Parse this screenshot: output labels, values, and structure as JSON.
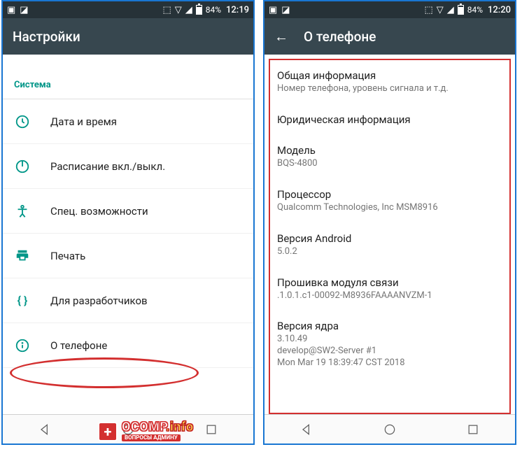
{
  "left": {
    "statusbar": {
      "battery": "84%",
      "time": "12:19"
    },
    "toolbar": {
      "title": "Настройки"
    },
    "section": "Система",
    "items": [
      {
        "label": "Дата и время"
      },
      {
        "label": "Расписание вкл./выкл."
      },
      {
        "label": "Спец. возможности"
      },
      {
        "label": "Печать"
      },
      {
        "label": "Для разработчиков"
      },
      {
        "label": "О телефоне"
      }
    ]
  },
  "right": {
    "statusbar": {
      "battery": "84%",
      "time": "12:20"
    },
    "toolbar": {
      "title": "О телефоне"
    },
    "info": [
      {
        "title": "Общая информация",
        "sub": "Номер телефона, уровень сигнала и т.д."
      },
      {
        "title": "Юридическая информация",
        "sub": ""
      },
      {
        "title": "Модель",
        "sub": "BQS-4800"
      },
      {
        "title": "Процессор",
        "sub": "Qualcomm Technologies, Inc MSM8916"
      },
      {
        "title": "Версия Android",
        "sub": "5.0.2"
      },
      {
        "title": "Прошивка модуля связи",
        "sub": ".1.0.1.c1-00092-M8936FAAAANVZM-1"
      },
      {
        "title": "Версия ядра",
        "sub": "3.10.49\ndevelop@SW2-Server #1\nMon Mar 19 18:39:47 CST 2018"
      }
    ]
  },
  "watermark": {
    "badge": "+",
    "main": "OCOMP",
    "suffix": ".info",
    "sub": "ВОПРОСЫ АДМИНУ"
  }
}
